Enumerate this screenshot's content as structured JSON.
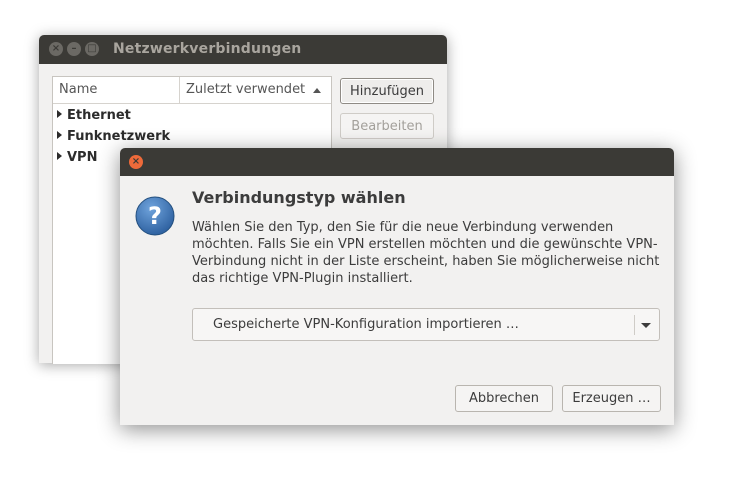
{
  "main_window": {
    "title": "Netzwerkverbindungen",
    "columns": {
      "name": "Name",
      "last_used": "Zuletzt verwendet"
    },
    "rows": [
      "Ethernet",
      "Funknetzwerk",
      "VPN"
    ],
    "buttons": {
      "add": "Hinzufügen",
      "edit": "Bearbeiten"
    }
  },
  "dialog": {
    "heading": "Verbindungstyp wählen",
    "body": "Wählen Sie den Typ, den Sie für die neue Verbindung verwenden möchten. Falls Sie ein VPN erstellen möchten und die gewünschte VPN-Verbindung nicht in der Liste erscheint, haben Sie möglicherweise nicht das richtige VPN-Plugin installiert.",
    "select_value": "Gespeicherte VPN-Konfiguration importieren …",
    "buttons": {
      "cancel": "Abbrechen",
      "create": "Erzeugen …"
    },
    "icon": "question-icon"
  },
  "colors": {
    "titlebar": "#3b3a36",
    "close_button": "#ee6a3a",
    "window_bg": "#f2f1f0",
    "question_icon": "#3f76b2"
  }
}
